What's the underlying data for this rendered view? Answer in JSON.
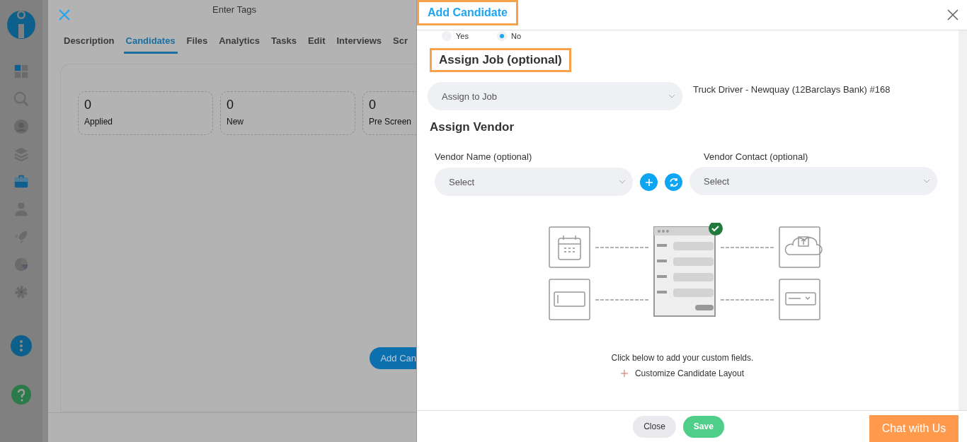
{
  "sidebar": {
    "items": [
      {
        "selected": false
      },
      {
        "selected": false
      },
      {
        "selected": false
      },
      {
        "selected": false
      },
      {
        "selected": true
      },
      {
        "selected": false
      },
      {
        "selected": false
      },
      {
        "selected": false
      },
      {
        "selected": false
      }
    ]
  },
  "background": {
    "title": "Enter Tags",
    "tabs": [
      {
        "label": "Description",
        "selected": false
      },
      {
        "label": "Candidates",
        "selected": true
      },
      {
        "label": "Files",
        "selected": false
      },
      {
        "label": "Analytics",
        "selected": false
      },
      {
        "label": "Tasks",
        "selected": false
      },
      {
        "label": "Edit",
        "selected": false
      },
      {
        "label": "Interviews",
        "selected": false
      },
      {
        "label": "Scr",
        "selected": false
      }
    ],
    "stages": [
      {
        "count": "0",
        "label": "Applied"
      },
      {
        "count": "0",
        "label": "New"
      },
      {
        "count": "0",
        "label": "Pre Screen"
      }
    ],
    "add_button": "Add Can"
  },
  "modal": {
    "title": "Add Candidate",
    "radios": [
      {
        "label": "Yes",
        "selected": false
      },
      {
        "label": "No",
        "selected": true
      }
    ],
    "assign_job": {
      "heading": "Assign Job (optional)",
      "placeholder": "Assign to Job",
      "job": "Truck Driver - Newquay (12Barclays Bank) #168"
    },
    "assign_vendor": {
      "heading": "Assign Vendor",
      "vendor_name_label": "Vendor Name (optional)",
      "vendor_name_placeholder": "Select",
      "vendor_contact_label": "Vendor Contact (optional)",
      "vendor_contact_placeholder": "Select"
    },
    "custom_hint": "Click below to add your custom fields.",
    "customize_link": "Customize Candidate Layout",
    "buttons": {
      "close": "Close",
      "save": "Save"
    }
  },
  "chat_button": "Chat with Us"
}
